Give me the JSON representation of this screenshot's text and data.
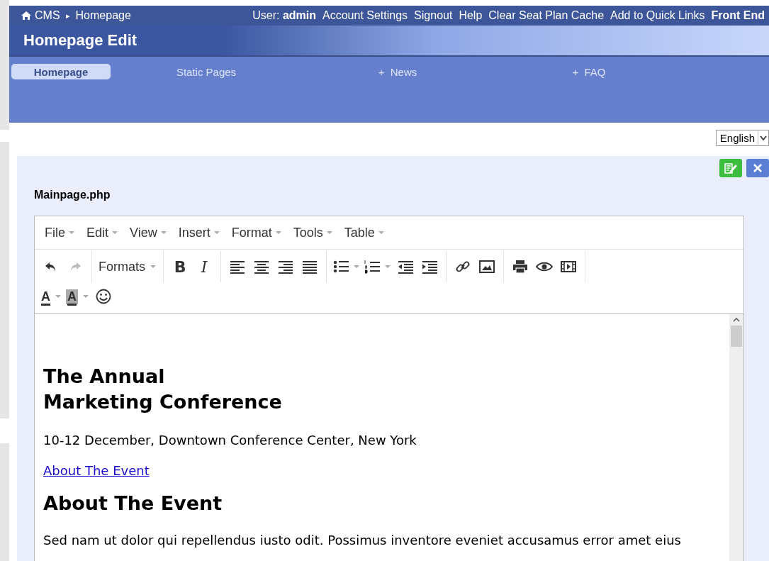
{
  "top_bar": {
    "home": "CMS",
    "crumb_sep": "▸",
    "crumb": "Homepage",
    "user_label": "User:",
    "user_name": "admin",
    "links": [
      "Account Settings",
      "Signout",
      "Help",
      "Clear Seat Plan Cache",
      "Add to Quick Links"
    ],
    "front_end": "Front End"
  },
  "page_title": "Homepage Edit",
  "tabs": [
    {
      "label": "Homepage",
      "selected": true
    },
    {
      "label": "Static Pages",
      "selected": false
    },
    {
      "label": "+  News",
      "selected": false
    },
    {
      "label": "+  FAQ",
      "selected": false
    }
  ],
  "language": "English",
  "file_label": "Mainpage.php",
  "menus": [
    "File",
    "Edit",
    "View",
    "Insert",
    "Format",
    "Tools",
    "Table"
  ],
  "toolbar": {
    "undo_disabled": false,
    "redo_disabled": true,
    "formats": "Formats",
    "bold": "B",
    "italic": "I",
    "text_color": "A",
    "background_color": "A"
  },
  "content": {
    "title_lines": [
      "The Annual",
      "Marketing Conference"
    ],
    "date": "10-12 December, Downtown Conference Center, New York",
    "link": "About The Event",
    "heading": "About The Event",
    "paragraph": "Sed nam ut dolor qui repellendus iusto odit. Possimus inventore eveniet accusamus error amet eius"
  }
}
